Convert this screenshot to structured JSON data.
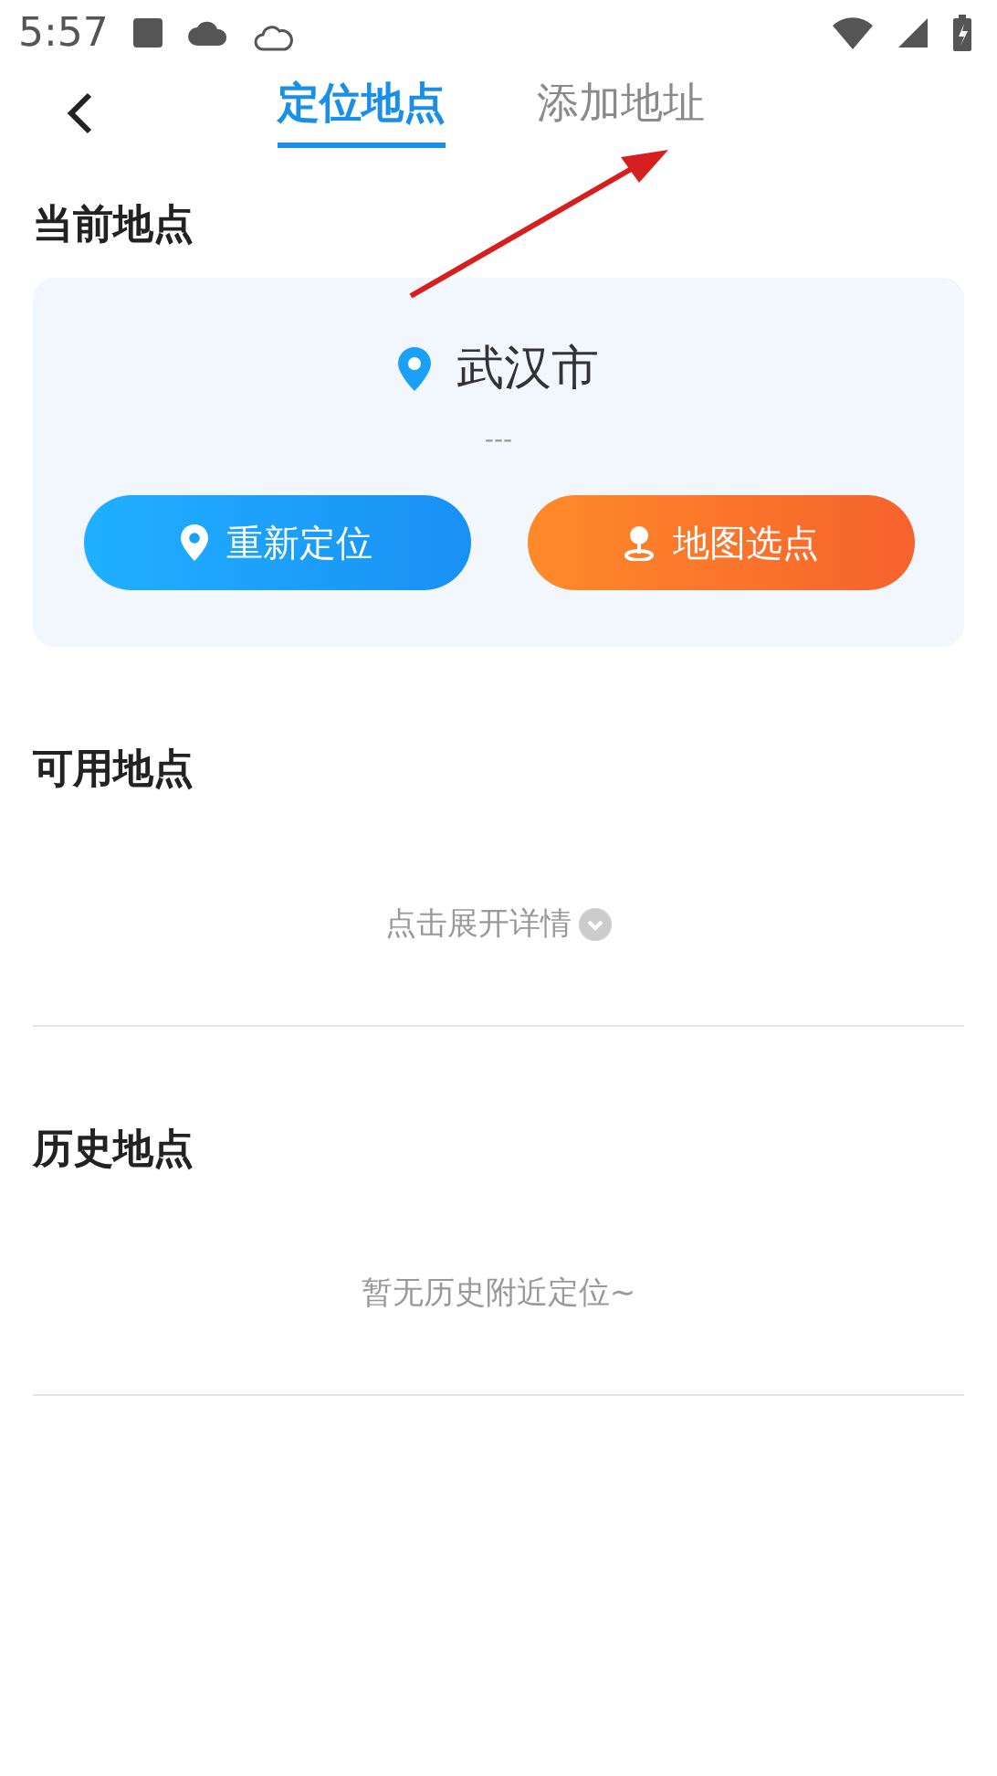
{
  "status_bar": {
    "time": "5:57"
  },
  "tabs": [
    {
      "label": "定位地点",
      "selected": true
    },
    {
      "label": "添加地址",
      "selected": false
    }
  ],
  "current": {
    "title": "当前地点",
    "city": "武汉市",
    "detail": "---",
    "buttons": [
      {
        "label": "重新定位",
        "kind": "relocate"
      },
      {
        "label": "地图选点",
        "kind": "map"
      }
    ]
  },
  "available": {
    "title": "可用地点",
    "expand": "点击展开详情"
  },
  "history": {
    "title": "历史地点",
    "empty": "暂无历史附近定位~"
  }
}
